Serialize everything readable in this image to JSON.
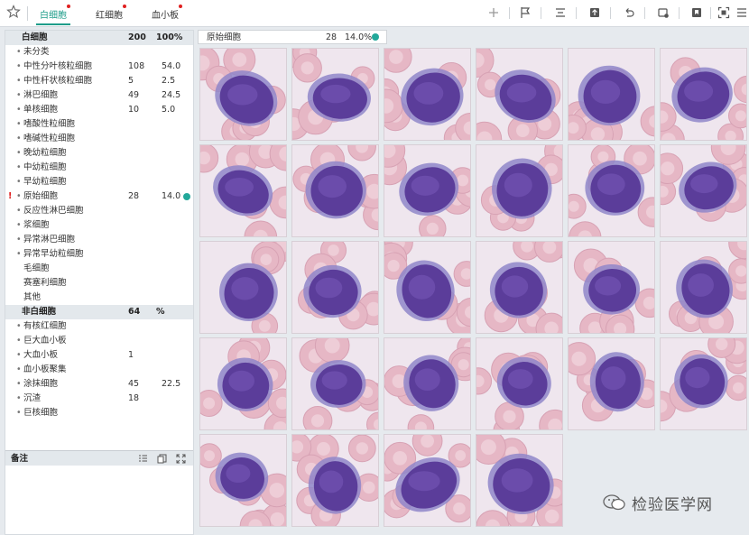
{
  "tabs": [
    {
      "label": "白细胞",
      "active": true
    },
    {
      "label": "红细胞",
      "active": false
    },
    {
      "label": "血小板",
      "active": false
    }
  ],
  "toolbar_icons": [
    "plus-icon",
    "flag-icon",
    "align-icon",
    "upload-icon",
    "undo-icon",
    "settings-icon",
    "bookmark-icon",
    "fit-screen-icon",
    "menu-icon"
  ],
  "table": {
    "wbc_header": {
      "name": "白细胞",
      "count": "200",
      "pct": "100%"
    },
    "wbc_rows": [
      {
        "name": "未分类",
        "count": "",
        "pct": ""
      },
      {
        "name": "中性分叶核粒细胞",
        "count": "108",
        "pct": "54.0"
      },
      {
        "name": "中性杆状核粒细胞",
        "count": "5",
        "pct": "2.5"
      },
      {
        "name": "淋巴细胞",
        "count": "49",
        "pct": "24.5"
      },
      {
        "name": "单核细胞",
        "count": "10",
        "pct": "5.0"
      },
      {
        "name": "嗜酸性粒细胞",
        "count": "",
        "pct": ""
      },
      {
        "name": "嗜碱性粒细胞",
        "count": "",
        "pct": ""
      },
      {
        "name": "晚幼粒细胞",
        "count": "",
        "pct": ""
      },
      {
        "name": "中幼粒细胞",
        "count": "",
        "pct": ""
      },
      {
        "name": "早幼粒细胞",
        "count": "",
        "pct": ""
      },
      {
        "name": "原始细胞",
        "count": "28",
        "pct": "14.0",
        "flag": "!",
        "status_color": "#22a89a"
      },
      {
        "name": "反应性淋巴细胞",
        "count": "",
        "pct": ""
      },
      {
        "name": "浆细胞",
        "count": "",
        "pct": ""
      },
      {
        "name": "异常淋巴细胞",
        "count": "",
        "pct": ""
      },
      {
        "name": "异常早幼粒细胞",
        "count": "",
        "pct": ""
      },
      {
        "name": "毛细胞",
        "count": "",
        "pct": "",
        "nobullet": true
      },
      {
        "name": "赛塞利细胞",
        "count": "",
        "pct": "",
        "nobullet": true
      },
      {
        "name": "其他",
        "count": "",
        "pct": "",
        "nobullet": true
      }
    ],
    "nonwbc_header": {
      "name": "非白细胞",
      "count": "64",
      "pct": "%"
    },
    "nonwbc_rows": [
      {
        "name": "有核红细胞",
        "count": "",
        "pct": ""
      },
      {
        "name": "巨大血小板",
        "count": "",
        "pct": ""
      },
      {
        "name": "大血小板",
        "count": "1",
        "pct": ""
      },
      {
        "name": "血小板聚集",
        "count": "",
        "pct": ""
      },
      {
        "name": "涂抹细胞",
        "count": "45",
        "pct": "22.5"
      },
      {
        "name": "沉渣",
        "count": "18",
        "pct": ""
      },
      {
        "name": "巨核细胞",
        "count": "",
        "pct": ""
      }
    ]
  },
  "notes": {
    "label": "备注",
    "icons": [
      "list-icon",
      "copy-icon",
      "expand-icon"
    ]
  },
  "cell_bar": {
    "name": "原始细胞",
    "count": "28",
    "pct": "14.0%",
    "status_color": "#22a89a"
  },
  "images": {
    "count": 28,
    "columns": 6
  },
  "watermark": {
    "text": "检验医学网"
  },
  "colors": {
    "accent": "#1f9d8a",
    "alert": "#e02020",
    "cell_nucleus": "#6e4aa8",
    "rbc": "#e4b6c4"
  }
}
